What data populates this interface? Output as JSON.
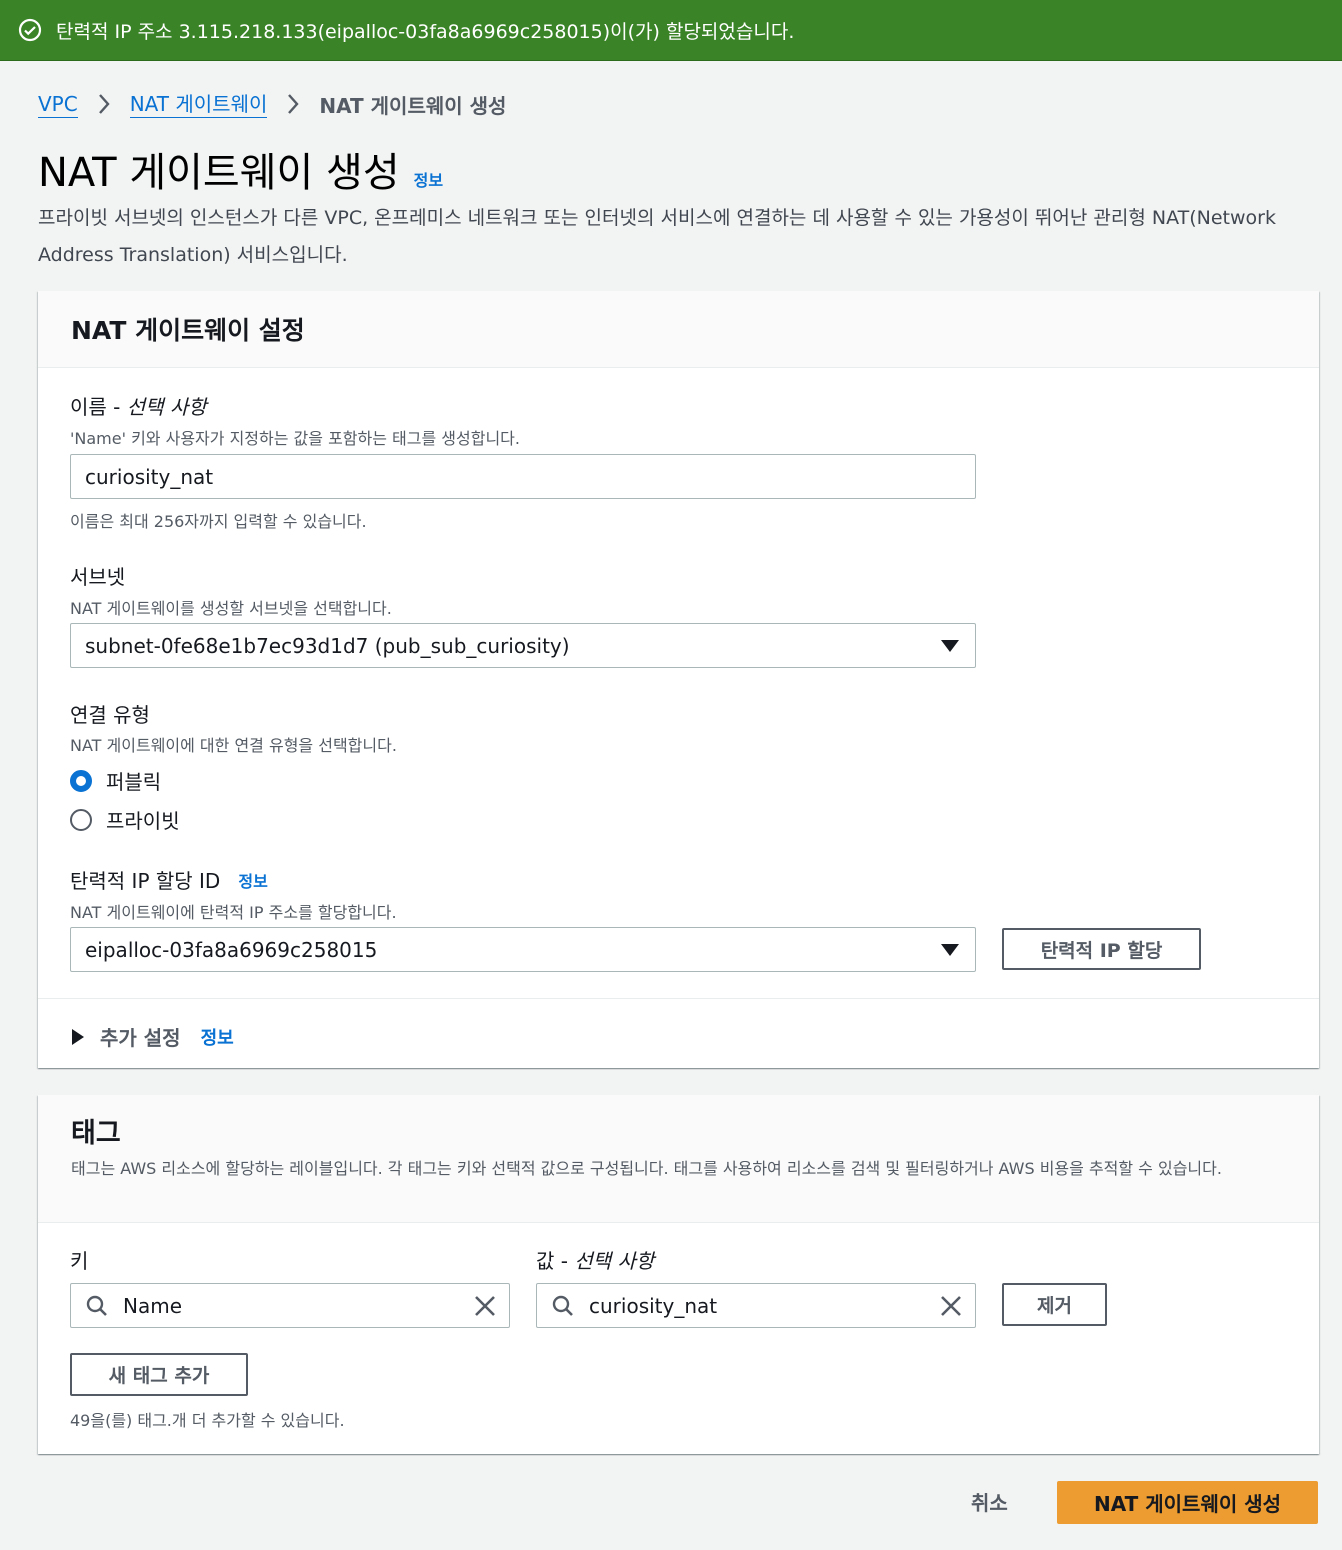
{
  "flash": {
    "message": "탄력적 IP 주소 3.115.218.133(eipalloc-03fa8a6969c258015)이(가) 할당되었습니다."
  },
  "breadcrumb": {
    "items": [
      "VPC",
      "NAT 게이트웨이"
    ],
    "current": "NAT 게이트웨이 생성"
  },
  "page": {
    "title": "NAT 게이트웨이 생성",
    "info": "정보",
    "description": "프라이빗 서브넷의 인스턴스가 다른 VPC, 온프레미스 네트워크 또는 인터넷의 서비스에 연결하는 데 사용할 수 있는 가용성이 뛰어난 관리형 NAT(Network Address Translation) 서비스입니다."
  },
  "settings": {
    "header": "NAT 게이트웨이 설정",
    "name": {
      "label": "이름 - ",
      "label_optional": "선택 사항",
      "description": "'Name' 키와 사용자가 지정하는 값을 포함하는 태그를 생성합니다.",
      "value": "curiosity_nat",
      "constraint": "이름은 최대 256자까지 입력할 수 있습니다."
    },
    "subnet": {
      "label": "서브넷",
      "description": "NAT 게이트웨이를 생성할 서브넷을 선택합니다.",
      "value": "subnet-0fe68e1b7ec93d1d7 (pub_sub_curiosity)"
    },
    "connectivity": {
      "label": "연결 유형",
      "description": "NAT 게이트웨이에 대한 연결 유형을 선택합니다.",
      "options": [
        "퍼블릭",
        "프라이빗"
      ],
      "selected": "퍼블릭"
    },
    "eip": {
      "label": "탄력적 IP 할당 ID",
      "info": "정보",
      "description": "NAT 게이트웨이에 탄력적 IP 주소를 할당합니다.",
      "value": "eipalloc-03fa8a6969c258015",
      "allocate_button": "탄력적 IP 할당"
    },
    "additional": {
      "label": "추가 설정",
      "info": "정보"
    }
  },
  "tags": {
    "header": "태그",
    "description": "태그는 AWS 리소스에 할당하는 레이블입니다. 각 태그는 키와 선택적 값으로 구성됩니다. 태그를 사용하여 리소스를 검색 및 필터링하거나 AWS 비용을 추적할 수 있습니다.",
    "key_label": "키",
    "value_label": "값 - ",
    "value_label_optional": "선택 사항",
    "key": "Name",
    "value": "curiosity_nat",
    "remove_button": "제거",
    "add_button": "새 태그 추가",
    "remaining": "49을(를) 태그.개 더 추가할 수 있습니다."
  },
  "footer": {
    "cancel": "취소",
    "create": "NAT 게이트웨이 생성"
  },
  "colors": {
    "flash_bg": "#3a8327",
    "link": "#0972d3",
    "primary": "#ec9c30"
  }
}
